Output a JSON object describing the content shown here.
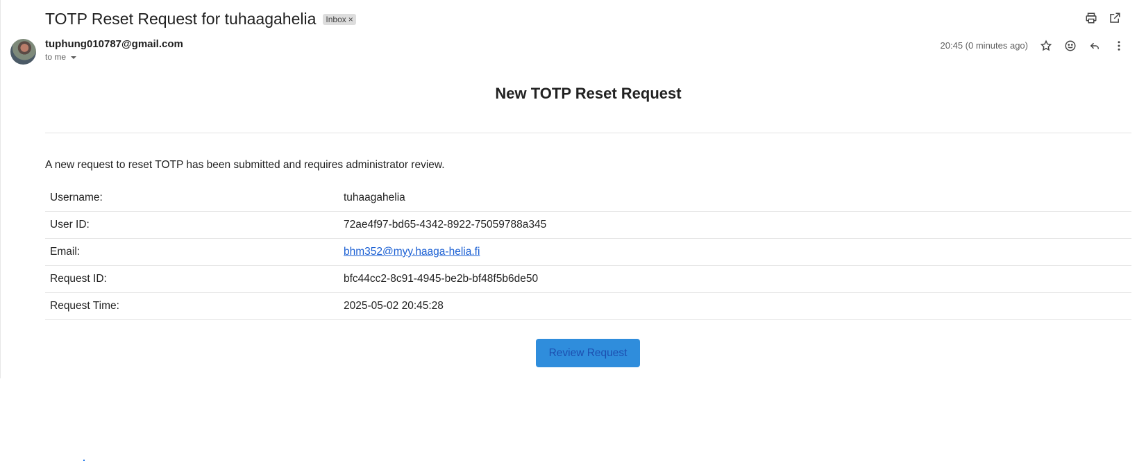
{
  "email": {
    "subject": "TOTP Reset Request for tuhaagahelia",
    "label": "Inbox",
    "label_remove": "×",
    "sender": "tuphung010787@gmail.com",
    "recipient": "to me",
    "time": "20:45 (0 minutes ago)"
  },
  "toolbar": {
    "icons": [
      "print-icon",
      "open-in-new-window-icon"
    ]
  },
  "message_actions": {
    "icons": [
      "star-icon",
      "emoji-reaction-icon",
      "reply-icon",
      "more-options-icon"
    ]
  },
  "body": {
    "title": "New TOTP Reset Request",
    "intro": "A new request to reset TOTP has been submitted and requires administrator review.",
    "rows": [
      {
        "key": "Username:",
        "value": "tuhaagahelia"
      },
      {
        "key": "User ID:",
        "value": "72ae4f97-bd65-4342-8922-75059788a345"
      },
      {
        "key": "Email:",
        "value": "bhm352@myy.haaga-helia.fi"
      },
      {
        "key": "Request ID:",
        "value": "bfc44cc2-8c91-4945-be2b-bf48f5b6de50"
      },
      {
        "key": "Request Time:",
        "value": "2025-05-02 20:45:28"
      }
    ],
    "button_label": "Review Request"
  },
  "colors": {
    "button_bg": "#2f8ddc",
    "link": "#1a5fd3",
    "chip_bg": "#dddddd"
  }
}
